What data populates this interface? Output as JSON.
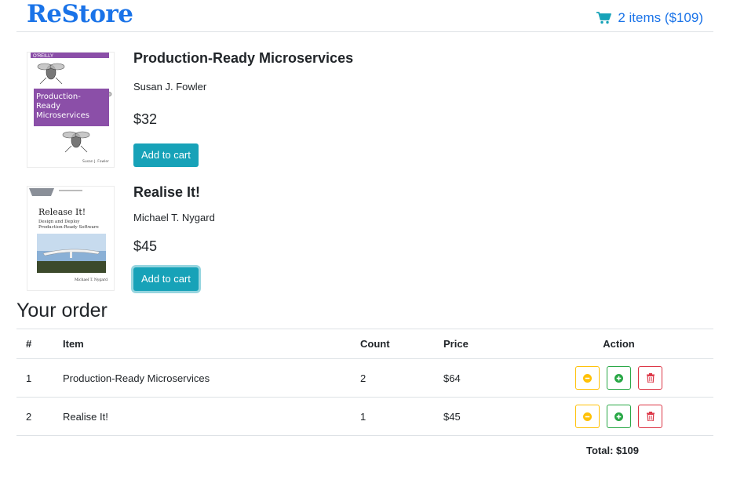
{
  "header": {
    "logo": "ReStore",
    "cart_summary": "2 items ($109)"
  },
  "books": [
    {
      "title": "Production-Ready Microservices",
      "author": "Susan J. Fowler",
      "price": "$32",
      "button": "Add to cart",
      "cover": {
        "publisher": "O'REILLY",
        "title_lines": [
          "Production-",
          "Ready",
          "Microservices"
        ],
        "author": "Susan J. Fowler",
        "accent": "#8b4fa8"
      }
    },
    {
      "title": "Realise It!",
      "author": "Michael T. Nygard",
      "price": "$45",
      "button": "Add to cart",
      "cover": {
        "title": "Release It!",
        "subtitle_lines": [
          "Design and Deploy",
          "Production-Ready Software"
        ],
        "author": "Michael T. Nygard"
      }
    }
  ],
  "order": {
    "title": "Your order",
    "columns": [
      "#",
      "Item",
      "Count",
      "Price",
      "Action"
    ],
    "rows": [
      {
        "num": "1",
        "item": "Production-Ready Microservices",
        "count": "2",
        "price": "$64"
      },
      {
        "num": "2",
        "item": "Realise It!",
        "count": "1",
        "price": "$45"
      }
    ],
    "total": "Total: $109"
  },
  "colors": {
    "brand": "#1a73e8",
    "button": "#17a2b8",
    "warning": "#ffc107",
    "success": "#28a745",
    "danger": "#dc3545"
  },
  "icons": [
    "shopping-cart-icon",
    "minus-circle-icon",
    "plus-circle-icon",
    "trash-icon"
  ]
}
